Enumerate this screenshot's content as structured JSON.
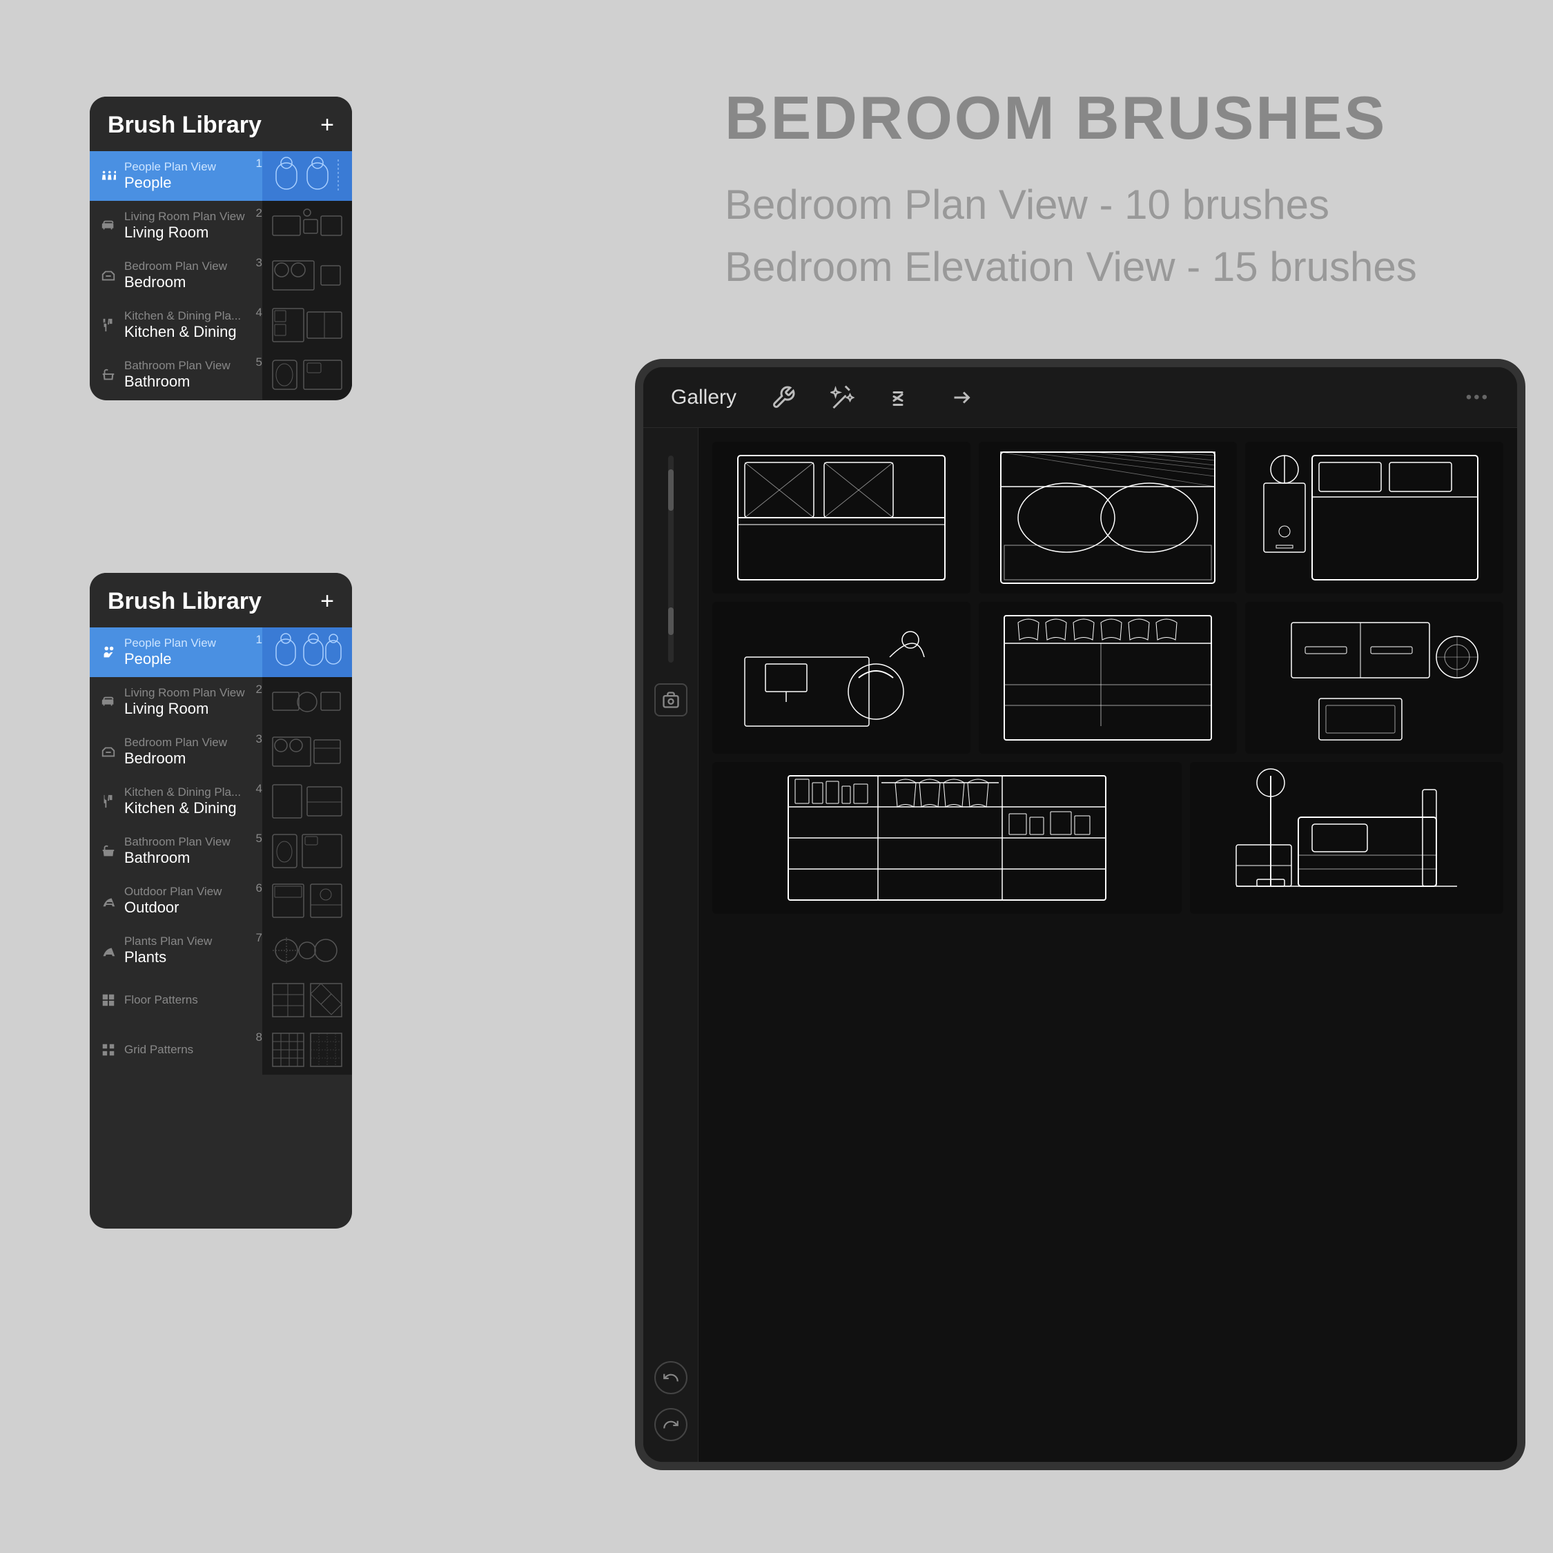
{
  "promo": {
    "title": "BEDROOM BRUSHES",
    "line1": "Bedroom Plan View - 10 brushes",
    "line2": "Bedroom Elevation View - 15 brushes"
  },
  "panel_top": {
    "title": "Brush Library",
    "plus": "+",
    "items": [
      {
        "label_top": "People Plan View",
        "label_main": "People",
        "num": "1",
        "selected": true
      },
      {
        "label_top": "Living Room Plan View",
        "label_main": "Living Room",
        "num": "2",
        "selected": false
      },
      {
        "label_top": "Bedroom Plan View",
        "label_main": "Bedroom",
        "num": "3",
        "selected": false
      },
      {
        "label_top": "Kitchen & Dining Pla...",
        "label_main": "Kitchen & Dining",
        "num": "4",
        "selected": false
      },
      {
        "label_top": "Bathroom Plan View",
        "label_main": "Bathroom",
        "num": "5",
        "selected": false
      }
    ]
  },
  "panel_bottom": {
    "title": "Brush Library",
    "plus": "+",
    "items": [
      {
        "label_top": "People Plan View",
        "label_main": "People",
        "num": "1",
        "selected": true
      },
      {
        "label_top": "Living Room Plan View",
        "label_main": "Living Room",
        "num": "2",
        "selected": false
      },
      {
        "label_top": "Bedroom Plan View",
        "label_main": "Bedroom",
        "num": "3",
        "selected": false
      },
      {
        "label_top": "Kitchen & Dining Pla...",
        "label_main": "Kitchen & Dining",
        "num": "4",
        "selected": false
      },
      {
        "label_top": "Bathroom Plan View",
        "label_main": "Bathroom",
        "num": "5",
        "selected": false
      },
      {
        "label_top": "Outdoor Plan View",
        "label_main": "Outdoor",
        "num": "6",
        "selected": false
      },
      {
        "label_top": "Plants Plan View",
        "label_main": "Plants",
        "num": "7",
        "selected": false
      },
      {
        "label_top": "Floor Patterns",
        "label_main": "",
        "num": "",
        "selected": false
      },
      {
        "label_top": "Grid Patterns",
        "label_main": "",
        "num": "8",
        "selected": false
      }
    ]
  },
  "tablet": {
    "gallery_label": "Gallery",
    "top_icons": [
      "wrench",
      "magic",
      "script",
      "arrow"
    ]
  }
}
